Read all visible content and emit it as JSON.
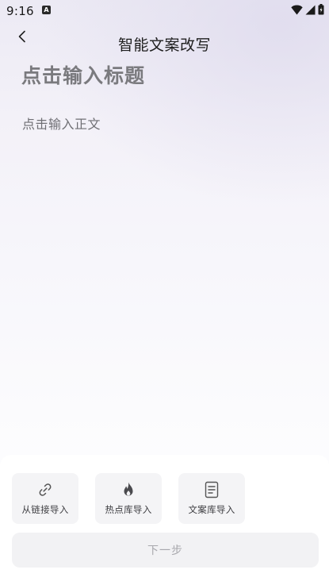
{
  "status_bar": {
    "time": "9:16",
    "notification_icon": "a-badge-icon",
    "icons": [
      "wifi-icon",
      "signal-icon",
      "battery-icon"
    ]
  },
  "header": {
    "back_icon": "chevron-left-icon",
    "title": "智能文案改写"
  },
  "editor": {
    "title_placeholder": "点击输入标题",
    "body_placeholder": "点击输入正文"
  },
  "import_options": [
    {
      "icon": "link-icon",
      "label": "从链接导入"
    },
    {
      "icon": "flame-icon",
      "label": "热点库导入"
    },
    {
      "icon": "document-icon",
      "label": "文案库导入"
    }
  ],
  "next_button": {
    "label": "下一步",
    "state": "disabled"
  },
  "colors": {
    "background_top": "#eceaf4",
    "panel": "#ffffff",
    "card": "#f4f4f6",
    "disabled_text": "#a8a8ad"
  }
}
